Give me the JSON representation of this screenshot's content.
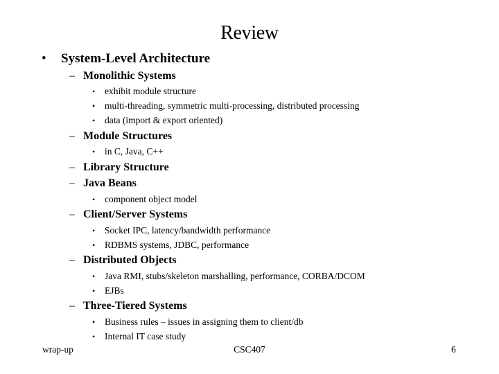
{
  "slide": {
    "title": "Review",
    "outline": [
      {
        "level": 1,
        "marker": "•",
        "text": "System-Level Architecture"
      },
      {
        "level": 2,
        "marker": "–",
        "text": "Monolithic Systems"
      },
      {
        "level": 3,
        "marker": "•",
        "text": "exhibit module structure"
      },
      {
        "level": 3,
        "marker": "•",
        "text": "multi-threading, symmetric multi-processing, distributed processing"
      },
      {
        "level": 3,
        "marker": "•",
        "text": "data (import & export oriented)"
      },
      {
        "level": 2,
        "marker": "–",
        "text": "Module Structures"
      },
      {
        "level": 3,
        "marker": "•",
        "text": "in C, Java, C++"
      },
      {
        "level": 2,
        "marker": "–",
        "text": "Library Structure"
      },
      {
        "level": 2,
        "marker": "–",
        "text": "Java Beans"
      },
      {
        "level": 3,
        "marker": "•",
        "text": "component object model"
      },
      {
        "level": 2,
        "marker": "–",
        "text": "Client/Server Systems"
      },
      {
        "level": 3,
        "marker": "•",
        "text": "Socket IPC, latency/bandwidth performance"
      },
      {
        "level": 3,
        "marker": "•",
        "text": "RDBMS systems, JDBC, performance"
      },
      {
        "level": 2,
        "marker": "–",
        "text": "Distributed Objects"
      },
      {
        "level": 3,
        "marker": "•",
        "text": "Java RMI, stubs/skeleton marshalling, performance, CORBA/DCOM"
      },
      {
        "level": 3,
        "marker": "•",
        "text": "EJBs"
      },
      {
        "level": 2,
        "marker": "–",
        "text": "Three-Tiered Systems"
      },
      {
        "level": 3,
        "marker": "•",
        "text": "Business rules – issues in assigning them to client/db"
      },
      {
        "level": 3,
        "marker": "•",
        "text": "Internal IT case study"
      }
    ],
    "footer": {
      "left": "wrap-up",
      "center": "CSC407",
      "page_number": "6"
    }
  }
}
